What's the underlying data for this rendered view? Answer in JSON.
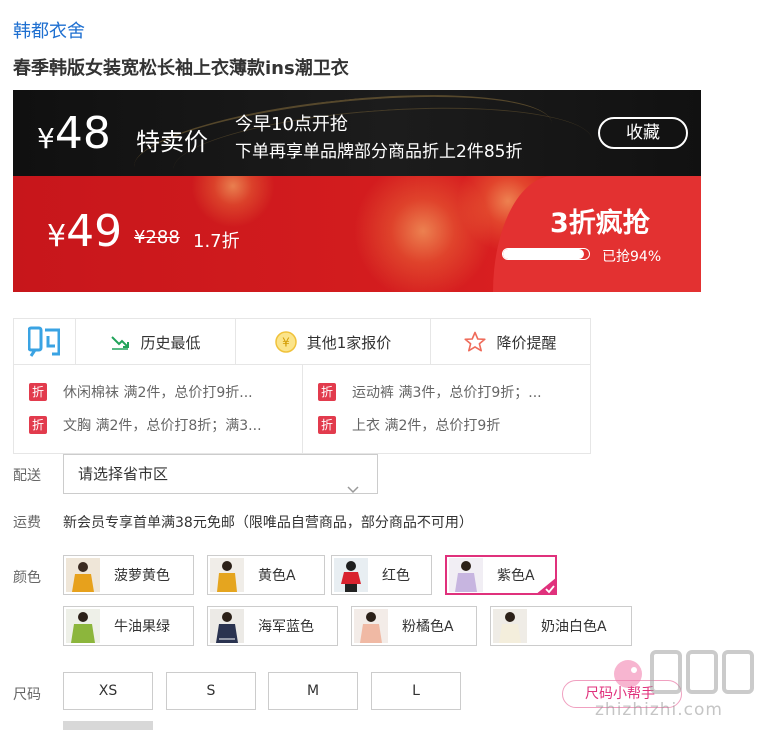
{
  "store_name": "韩都衣舍",
  "product_title": "春季韩版女装宽松长袖上衣薄款ins潮卫衣",
  "flash_banner": {
    "currency": "¥",
    "price": "48",
    "label": "特卖价",
    "presale_line1": "今早10点开抢",
    "presale_line2": "下单再享单品牌部分商品折上2件85折",
    "favorite_label": "收藏"
  },
  "sale_banner": {
    "currency": "¥",
    "price": "49",
    "original_price": "¥288",
    "discount": "1.7折",
    "headline": "3折疯抢",
    "sold_label": "已抢94%",
    "sold_fraction": 0.94
  },
  "price_info": {
    "history_low": "历史最低",
    "other_offers": "其他1家报价",
    "price_alert": "降价提醒",
    "promo_badge": "折",
    "promos": [
      "休闲棉袜 满2件，总价打9折...",
      "运动裤 满3件，总价打9折；...",
      "文胸 满2件，总价打8折；满3...",
      "上衣 满2件，总价打9折"
    ]
  },
  "delivery": {
    "label": "配送",
    "placeholder": "请选择省市区"
  },
  "shipping": {
    "label": "运费",
    "text": "新会员专享首单满38元免邮（限唯品自营商品，部分商品不可用）"
  },
  "colors": {
    "label": "颜色",
    "options": [
      "菠萝黄色",
      "黄色A",
      "红色",
      "紫色A",
      "牛油果绿",
      "海军蓝色",
      "粉橘色A",
      "奶油白色A"
    ],
    "selected": "紫色A"
  },
  "sizes": {
    "label": "尺码",
    "options": [
      "XS",
      "S",
      "M",
      "L"
    ],
    "helper": "尺码小帮手"
  },
  "watermark": "zhizhizhi.com",
  "colors_theme": {
    "accent_pink": "#e0317c",
    "sale_red": "#d51d1f",
    "link_blue": "#1e6fd0"
  }
}
